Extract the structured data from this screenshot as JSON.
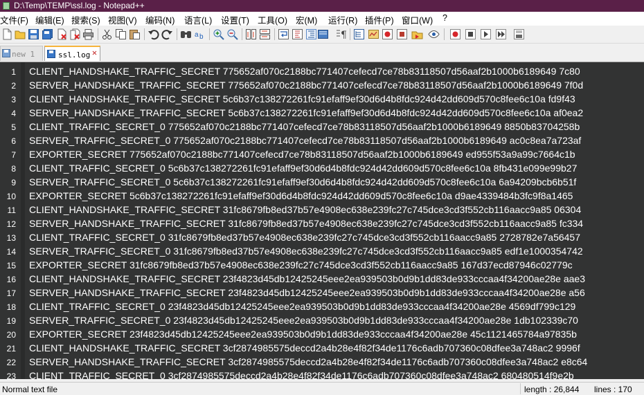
{
  "window": {
    "title": "D:\\Temp\\TEMP\\ssl.log - Notepad++"
  },
  "menu": [
    "文件(F)",
    "编辑(E)",
    "搜索(S)",
    "视图(V)",
    "编码(N)",
    "语言(L)",
    "设置(T)",
    "工具(O)",
    "宏(M)",
    "运行(R)",
    "插件(P)",
    "窗口(W)",
    "?"
  ],
  "toolbar": {
    "icons": [
      "new-file-icon",
      "open-file-icon",
      "save-icon",
      "save-all-icon",
      "close-icon",
      "close-all-icon",
      "print-icon",
      "cut-icon",
      "copy-icon",
      "paste-icon",
      "undo-icon",
      "redo-icon",
      "find-icon",
      "replace-icon",
      "zoom-in-icon",
      "zoom-out-icon",
      "sync-vertical-icon",
      "sync-horizontal-icon",
      "word-wrap-icon",
      "show-all-chars-icon",
      "indent-guide-icon",
      "document-map-icon",
      "function-list-icon",
      "folder-as-workspace-icon",
      "monitoring-icon",
      "record-macro-icon",
      "stop-record-icon",
      "play-macro-icon",
      "run-macro-multiple-icon",
      "save-macro-icon"
    ]
  },
  "tabs": [
    {
      "label": "new 1",
      "active": false
    },
    {
      "label": "ssl.log",
      "active": true
    }
  ],
  "editor": {
    "lines": [
      {
        "n": "1",
        "text": "CLIENT_HANDSHAKE_TRAFFIC_SECRET 775652af070c2188bc771407cefecd7ce78b83118507d56aaf2b1000b6189649 7c80"
      },
      {
        "n": "2",
        "text": "SERVER_HANDSHAKE_TRAFFIC_SECRET 775652af070c2188bc771407cefecd7ce78b83118507d56aaf2b1000b6189649 7f0d"
      },
      {
        "n": "3",
        "text": "CLIENT_HANDSHAKE_TRAFFIC_SECRET 5c6b37c138272261fc91efaff9ef30d6d4b8fdc924d42dd609d570c8fee6c10a fd9f43"
      },
      {
        "n": "4",
        "text": "SERVER_HANDSHAKE_TRAFFIC_SECRET 5c6b37c138272261fc91efaff9ef30d6d4b8fdc924d42dd609d570c8fee6c10a af0ea2"
      },
      {
        "n": "5",
        "text": "CLIENT_TRAFFIC_SECRET_0 775652af070c2188bc771407cefecd7ce78b83118507d56aaf2b1000b6189649 8850b83704258b"
      },
      {
        "n": "6",
        "text": "SERVER_TRAFFIC_SECRET_0 775652af070c2188bc771407cefecd7ce78b83118507d56aaf2b1000b6189649 ac0c8ea7a723af"
      },
      {
        "n": "7",
        "text": "EXPORTER_SECRET 775652af070c2188bc771407cefecd7ce78b83118507d56aaf2b1000b6189649 ed955f53a9a99c7664c1b"
      },
      {
        "n": "8",
        "text": "CLIENT_TRAFFIC_SECRET_0 5c6b37c138272261fc91efaff9ef30d6d4b8fdc924d42dd609d570c8fee6c10a 8fb431e099e99b27"
      },
      {
        "n": "9",
        "text": "SERVER_TRAFFIC_SECRET_0 5c6b37c138272261fc91efaff9ef30d6d4b8fdc924d42dd609d570c8fee6c10a 6a94209bcb6b51f"
      },
      {
        "n": "10",
        "text": "EXPORTER_SECRET 5c6b37c138272261fc91efaff9ef30d6d4b8fdc924d42dd609d570c8fee6c10a d9ae4339484b3fc9f8a1465"
      },
      {
        "n": "11",
        "text": "CLIENT_HANDSHAKE_TRAFFIC_SECRET 31fc8679fb8ed37b57e4908ec638e239fc27c745dce3cd3f552cb116aacc9a85 06304"
      },
      {
        "n": "12",
        "text": "SERVER_HANDSHAKE_TRAFFIC_SECRET 31fc8679fb8ed37b57e4908ec638e239fc27c745dce3cd3f552cb116aacc9a85 fc334"
      },
      {
        "n": "13",
        "text": "CLIENT_TRAFFIC_SECRET_0 31fc8679fb8ed37b57e4908ec638e239fc27c745dce3cd3f552cb116aacc9a85 2728782e7a56457"
      },
      {
        "n": "14",
        "text": "SERVER_TRAFFIC_SECRET_0 31fc8679fb8ed37b57e4908ec638e239fc27c745dce3cd3f552cb116aacc9a85 edf1e1000354742"
      },
      {
        "n": "15",
        "text": "EXPORTER_SECRET 31fc8679fb8ed37b57e4908ec638e239fc27c745dce3cd3f552cb116aacc9a85 167d37ecd87946c02779c"
      },
      {
        "n": "16",
        "text": "CLIENT_HANDSHAKE_TRAFFIC_SECRET 23f4823d45db12425245eee2ea939503b0d9b1dd83de933cccaa4f34200ae28e aae3"
      },
      {
        "n": "17",
        "text": "SERVER_HANDSHAKE_TRAFFIC_SECRET 23f4823d45db12425245eee2ea939503b0d9b1dd83de933cccaa4f34200ae28e a56"
      },
      {
        "n": "18",
        "text": "CLIENT_TRAFFIC_SECRET_0 23f4823d45db12425245eee2ea939503b0d9b1dd83de933cccaa4f34200ae28e 4569df799c129"
      },
      {
        "n": "19",
        "text": "SERVER_TRAFFIC_SECRET_0 23f4823d45db12425245eee2ea939503b0d9b1dd83de933cccaa4f34200ae28e 1db102339c70"
      },
      {
        "n": "20",
        "text": "EXPORTER_SECRET 23f4823d45db12425245eee2ea939503b0d9b1dd83de933cccaa4f34200ae28e 45c1121465784a97835b"
      },
      {
        "n": "21",
        "text": "CLIENT_HANDSHAKE_TRAFFIC_SECRET 3cf2874985575deccd2a4b28e4f82f34de1176c6adb707360c08dfee3a748ac2 9996f"
      },
      {
        "n": "22",
        "text": "SERVER_HANDSHAKE_TRAFFIC_SECRET 3cf2874985575deccd2a4b28e4f82f34de1176c6adb707360c08dfee3a748ac2 e8c64"
      },
      {
        "n": "23",
        "text": "CLIENT_TRAFFIC_SECRET_0 3cf2874985575deccd2a4b28e4f82f34de1176c6adb707360c08dfee3a748ac2 680480514f9e2b"
      }
    ]
  },
  "status": {
    "file_type": "Normal text file",
    "length": "length : 26,844",
    "lines": "lines : 170"
  }
}
